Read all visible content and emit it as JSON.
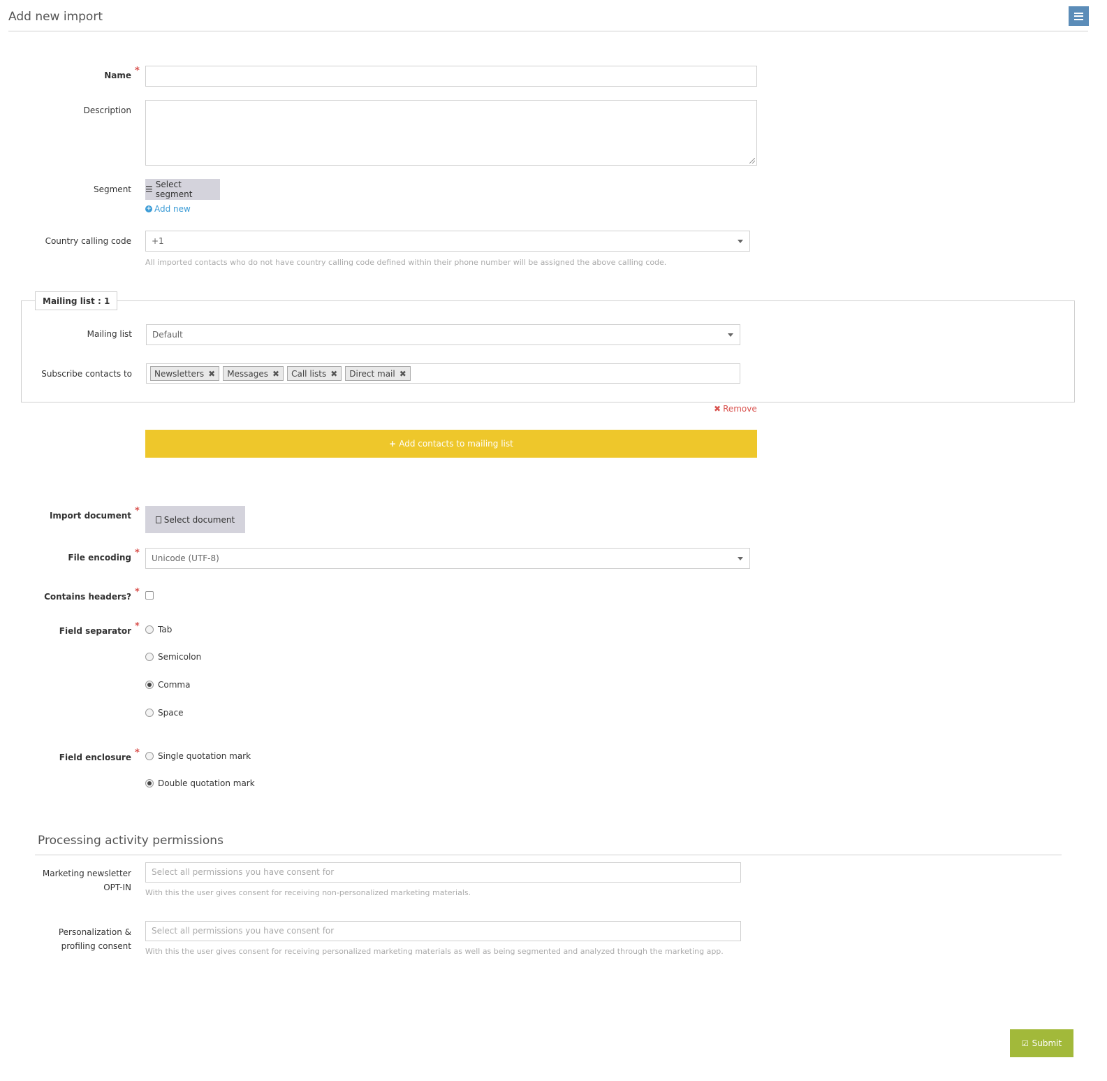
{
  "page": {
    "title": "Add new import"
  },
  "form": {
    "name": {
      "label": "Name",
      "value": ""
    },
    "description": {
      "label": "Description",
      "value": ""
    },
    "segment": {
      "label": "Segment",
      "button_label": "Select segment",
      "add_new_label": "Add new"
    },
    "country_code": {
      "label": "Country calling code",
      "value": "+1",
      "help": "All imported contacts who do not have country calling code defined within their phone number will be assigned the above calling code."
    },
    "mailing_list": {
      "legend": "Mailing list : 1",
      "list_label": "Mailing list",
      "list_value": "Default",
      "subscribe_label": "Subscribe contacts to",
      "tags": [
        "Newsletters",
        "Messages",
        "Call lists",
        "Direct mail"
      ],
      "tag_remove_glyph": "✖",
      "remove_label": "Remove",
      "add_button_label": "Add contacts to mailing list"
    },
    "import_document": {
      "label": "Import document",
      "button_label": "Select document"
    },
    "file_encoding": {
      "label": "File encoding",
      "value": "Unicode (UTF-8)"
    },
    "contains_headers": {
      "label": "Contains headers?",
      "checked": false
    },
    "field_separator": {
      "label": "Field separator",
      "options": [
        "Tab",
        "Semicolon",
        "Comma",
        "Space"
      ],
      "selected": "Comma"
    },
    "field_enclosure": {
      "label": "Field enclosure",
      "options": [
        "Single quotation mark",
        "Double quotation mark"
      ],
      "selected": "Double quotation mark"
    },
    "required_marker": "*"
  },
  "permissions": {
    "title": "Processing activity permissions",
    "marketing": {
      "label_line1": "Marketing newsletter",
      "label_line2": "OPT-IN",
      "placeholder": "Select all permissions you have consent for",
      "help": "With this the user gives consent for receiving non-personalized marketing materials."
    },
    "personalization": {
      "label_line1": "Personalization &",
      "label_line2": "profiling consent",
      "placeholder": "Select all permissions you have consent for",
      "help": "With this the user gives consent for receiving personalized marketing materials as well as being segmented and analyzed through the marketing app."
    }
  },
  "actions": {
    "submit_label": "Submit"
  },
  "colors": {
    "accent_blue": "#5b8cb8",
    "yellow_button": "#eec72b",
    "submit_green": "#a2b93a",
    "required_red": "#d9534f",
    "link_blue": "#3a9bd6"
  }
}
